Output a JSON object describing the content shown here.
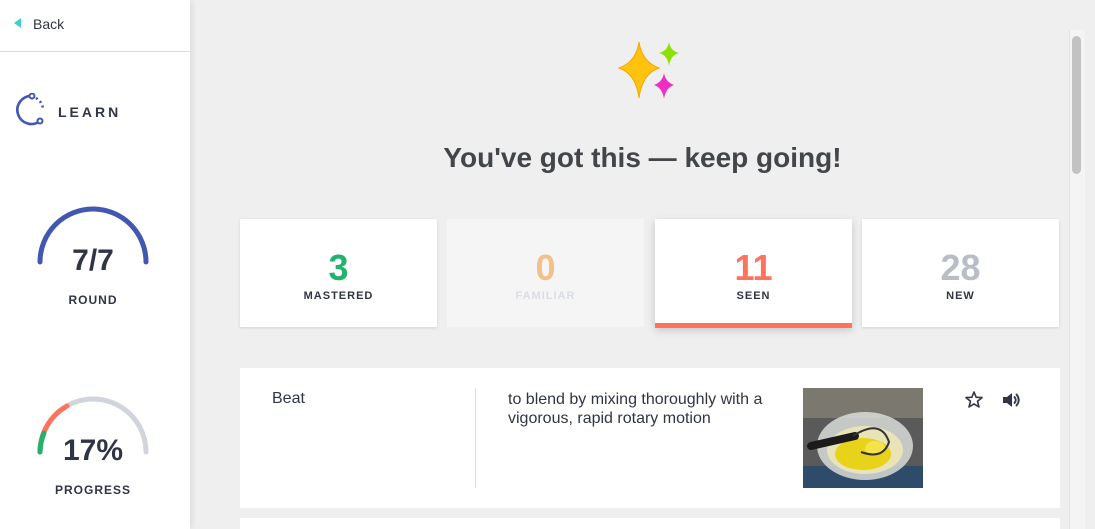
{
  "sidebar": {
    "back_label": "Back",
    "mode_label": "LEARN",
    "round": {
      "value": "7/7",
      "label": "ROUND",
      "fraction": 1.0
    },
    "progress": {
      "value": "17%",
      "label": "PROGRESS",
      "fraction": 0.17
    }
  },
  "main": {
    "headline": "You've got this — keep going!",
    "stats": [
      {
        "count": "3",
        "label": "MASTERED"
      },
      {
        "count": "0",
        "label": "FAMILIAR"
      },
      {
        "count": "11",
        "label": "SEEN"
      },
      {
        "count": "28",
        "label": "NEW"
      }
    ],
    "term_card": {
      "term": "Beat",
      "definition": "to blend by mixing thoroughly with a vigorous, rapid rotary motion"
    }
  },
  "colors": {
    "accent_blue": "#4257b2",
    "mastered": "#23b26d",
    "familiar": "#ffbc75",
    "seen": "#ff725b",
    "new": "#b8bdc6",
    "back_arrow": "#3ccfcf"
  },
  "icons": [
    "back-arrow-icon",
    "learn-mode-icon",
    "sparkles-icon",
    "star-icon",
    "speaker-icon"
  ]
}
